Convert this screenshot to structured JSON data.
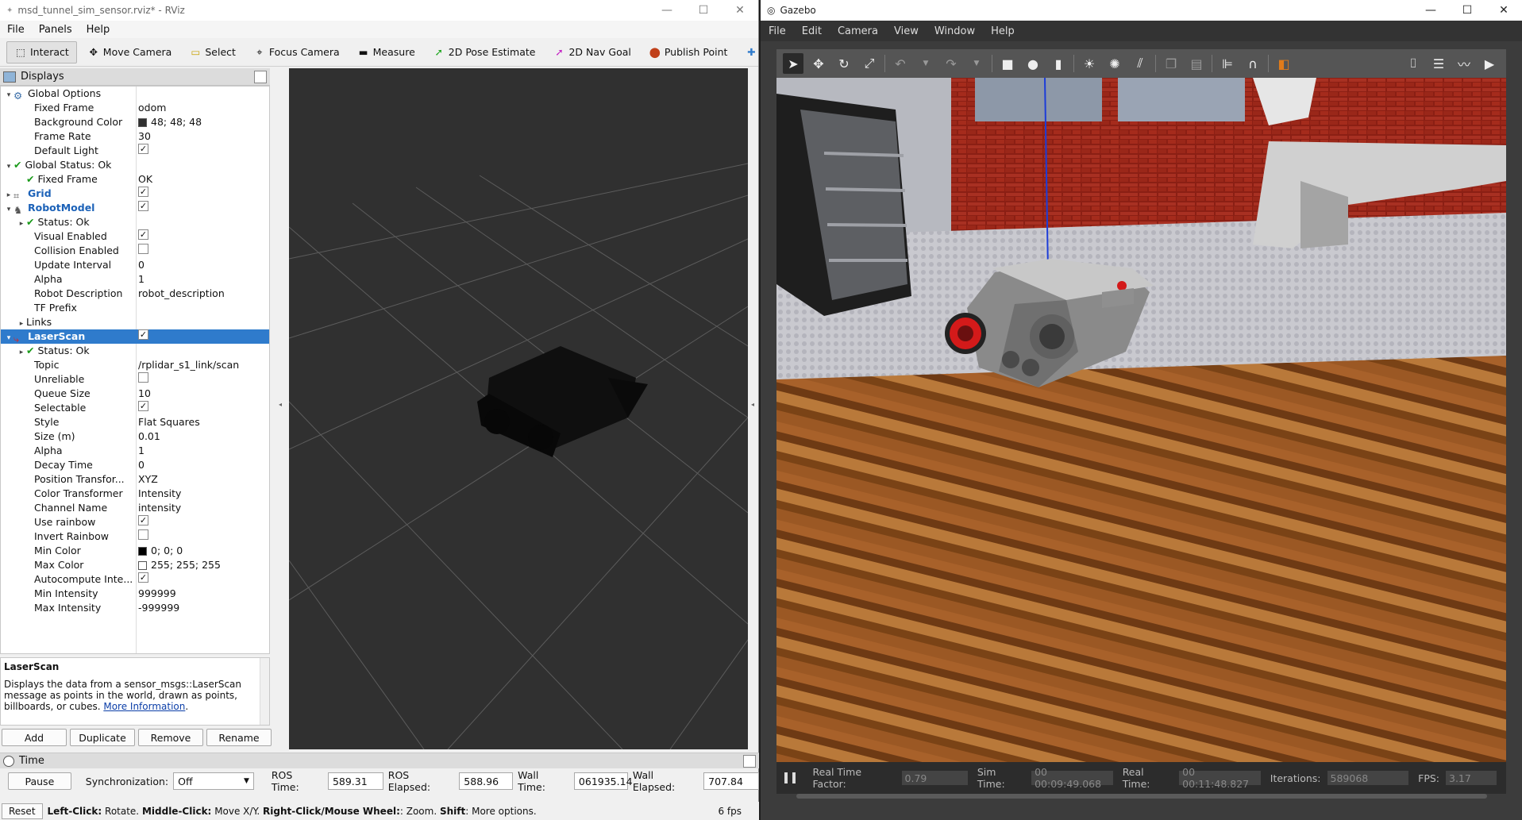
{
  "rviz": {
    "window_title": "msd_tunnel_sim_sensor.rviz* - RViz",
    "menu": [
      "File",
      "Panels",
      "Help"
    ],
    "tools": [
      {
        "label": "Interact",
        "icon": "cursor-icon"
      },
      {
        "label": "Move Camera",
        "icon": "move-icon"
      },
      {
        "label": "Select",
        "icon": "select-icon"
      },
      {
        "label": "Focus Camera",
        "icon": "focus-icon"
      },
      {
        "label": "Measure",
        "icon": "ruler-icon"
      },
      {
        "label": "2D Pose Estimate",
        "icon": "green-arrow-icon"
      },
      {
        "label": "2D Nav Goal",
        "icon": "magenta-arrow-icon"
      },
      {
        "label": "Publish Point",
        "icon": "pin-icon"
      }
    ],
    "displays_title": "Displays",
    "tree": [
      {
        "name": "Global Options",
        "indent": 0,
        "arrow": "open",
        "icon": "gear"
      },
      {
        "name": "Fixed Frame",
        "indent": 2,
        "value": "odom"
      },
      {
        "name": "Background Color",
        "indent": 2,
        "value": "48; 48; 48",
        "swatch": "#303030"
      },
      {
        "name": "Frame Rate",
        "indent": 2,
        "value": "30"
      },
      {
        "name": "Default Light",
        "indent": 2,
        "check": true
      },
      {
        "name": "Global Status: Ok",
        "indent": 0,
        "arrow": "open",
        "icon": "ok"
      },
      {
        "name": "Fixed Frame",
        "indent": 1,
        "value": "OK",
        "icon": "ok"
      },
      {
        "name": "Grid",
        "indent": 0,
        "arrow": "closed",
        "icon": "grid",
        "blue": true,
        "check": true
      },
      {
        "name": "RobotModel",
        "indent": 0,
        "arrow": "open",
        "icon": "robot",
        "blue": true,
        "check": true
      },
      {
        "name": "Status: Ok",
        "indent": 1,
        "arrow": "closed",
        "icon": "ok"
      },
      {
        "name": "Visual Enabled",
        "indent": 2,
        "check": true
      },
      {
        "name": "Collision Enabled",
        "indent": 2,
        "check": false
      },
      {
        "name": "Update Interval",
        "indent": 2,
        "value": "0"
      },
      {
        "name": "Alpha",
        "indent": 2,
        "value": "1"
      },
      {
        "name": "Robot Description",
        "indent": 2,
        "value": "robot_description"
      },
      {
        "name": "TF Prefix",
        "indent": 2,
        "value": ""
      },
      {
        "name": "Links",
        "indent": 1,
        "arrow": "closed"
      },
      {
        "name": "LaserScan",
        "indent": 0,
        "arrow": "open",
        "icon": "laser",
        "blue": true,
        "check": true,
        "selected": true
      },
      {
        "name": "Status: Ok",
        "indent": 1,
        "arrow": "closed",
        "icon": "ok"
      },
      {
        "name": "Topic",
        "indent": 2,
        "value": "/rplidar_s1_link/scan"
      },
      {
        "name": "Unreliable",
        "indent": 2,
        "check": false
      },
      {
        "name": "Queue Size",
        "indent": 2,
        "value": "10"
      },
      {
        "name": "Selectable",
        "indent": 2,
        "check": true
      },
      {
        "name": "Style",
        "indent": 2,
        "value": "Flat Squares"
      },
      {
        "name": "Size (m)",
        "indent": 2,
        "value": "0.01"
      },
      {
        "name": "Alpha",
        "indent": 2,
        "value": "1"
      },
      {
        "name": "Decay Time",
        "indent": 2,
        "value": "0"
      },
      {
        "name": "Position Transfor...",
        "indent": 2,
        "value": "XYZ"
      },
      {
        "name": "Color Transformer",
        "indent": 2,
        "value": "Intensity"
      },
      {
        "name": "Channel Name",
        "indent": 2,
        "value": "intensity"
      },
      {
        "name": "Use rainbow",
        "indent": 2,
        "check": true
      },
      {
        "name": "Invert Rainbow",
        "indent": 2,
        "check": false
      },
      {
        "name": "Min Color",
        "indent": 2,
        "value": "0; 0; 0",
        "swatch": "#000000"
      },
      {
        "name": "Max Color",
        "indent": 2,
        "value": "255; 255; 255",
        "swatch": "#ffffff"
      },
      {
        "name": "Autocompute Inte...",
        "indent": 2,
        "check": true
      },
      {
        "name": "Min Intensity",
        "indent": 2,
        "value": "999999"
      },
      {
        "name": "Max Intensity",
        "indent": 2,
        "value": "-999999"
      }
    ],
    "description": {
      "title": "LaserScan",
      "text": "Displays the data from a sensor_msgs::LaserScan message as points in the world, drawn as points, billboards, or cubes.",
      "link": "More Information"
    },
    "panel_buttons": [
      "Add",
      "Duplicate",
      "Remove",
      "Rename"
    ],
    "time": {
      "title": "Time",
      "pause": "Pause",
      "sync_label": "Synchronization:",
      "sync_value": "Off",
      "ros_time_label": "ROS Time:",
      "ros_time": "589.31",
      "ros_elapsed_label": "ROS Elapsed:",
      "ros_elapsed": "588.96",
      "wall_time_label": "Wall Time:",
      "wall_time": "061935.14",
      "wall_elapsed_label": "Wall Elapsed:",
      "wall_elapsed": "707.84"
    },
    "status": {
      "reset": "Reset",
      "left_click": "Left-Click:",
      "left_click_desc": "Rotate.",
      "middle_click": "Middle-Click:",
      "middle_click_desc": "Move X/Y.",
      "right_click": "Right-Click/Mouse Wheel:",
      "right_click_desc": ": Zoom.",
      "shift": "Shift",
      "shift_desc": ": More options.",
      "fps": "6 fps"
    },
    "background_color": "#303030",
    "selection_color": "#2f7bcc"
  },
  "gazebo": {
    "window_title": "Gazebo",
    "menu": [
      "File",
      "Edit",
      "Camera",
      "View",
      "Window",
      "Help"
    ],
    "bottom": {
      "rtf_label": "Real Time Factor:",
      "rtf": "0.79",
      "sim_time_label": "Sim Time:",
      "sim_time": "00 00:09:49.068",
      "real_time_label": "Real Time:",
      "real_time": "00 00:11:48.827",
      "iterations_label": "Iterations:",
      "iterations": "589068",
      "fps_label": "FPS:",
      "fps": "3.17"
    }
  }
}
